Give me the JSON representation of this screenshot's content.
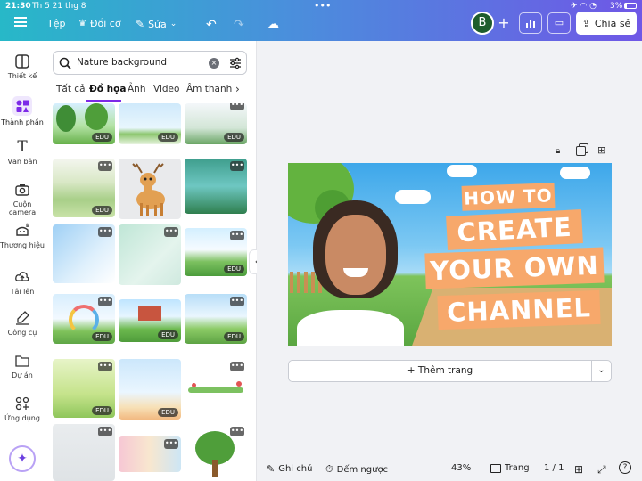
{
  "status_bar": {
    "time": "21:30",
    "date": "Th 5 21 thg 8",
    "battery": "3%"
  },
  "toolbar": {
    "file_label": "Tệp",
    "resize_label": "Đổi cỡ",
    "edit_label": "Sửa",
    "avatar_letter": "B",
    "share_label": "Chia sẻ"
  },
  "sidebar": {
    "items": [
      {
        "label": "Thiết kế",
        "icon": "layout-icon"
      },
      {
        "label": "Thành phần",
        "icon": "elements-icon"
      },
      {
        "label": "Văn bản",
        "icon": "text-icon"
      },
      {
        "label": "Cuộn camera",
        "icon": "camera-icon"
      },
      {
        "label": "Thương hiệu",
        "icon": "brand-icon"
      },
      {
        "label": "Tải lên",
        "icon": "upload-icon"
      },
      {
        "label": "Công cụ",
        "icon": "draw-icon"
      },
      {
        "label": "Dự án",
        "icon": "folder-icon"
      },
      {
        "label": "Ứng dụng",
        "icon": "apps-icon"
      }
    ]
  },
  "search": {
    "value": "Nature background"
  },
  "tabs": [
    {
      "label": "Tất cả",
      "active": false
    },
    {
      "label": "Đồ họa",
      "active": true
    },
    {
      "label": "Ảnh",
      "active": false
    },
    {
      "label": "Video",
      "active": false
    },
    {
      "label": "Âm thanh",
      "active": false
    }
  ],
  "badge_label": "EDU",
  "more_label": "•••",
  "design": {
    "line1": "HOW TO",
    "line2": "CREATE",
    "line3": "YOUR OWN",
    "line4": "CHANNEL"
  },
  "add_page_label": "+ Thêm trang",
  "bottom": {
    "notes_label": "Ghi chú",
    "timer_label": "Đếm ngược",
    "zoom": "43%",
    "pages_label": "Trang",
    "page_count": "1 / 1"
  },
  "colors": {
    "accent": "#7d2ae8",
    "banner_orange": "#f7a86b"
  }
}
